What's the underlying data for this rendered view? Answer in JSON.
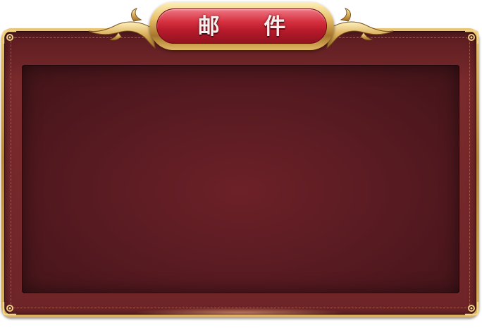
{
  "window": {
    "title": "邮 件"
  },
  "colors": {
    "frame_gold": "#d8b060",
    "panel_red": "#6e2528",
    "content_red": "#5a1b22",
    "title_red": "#d6303f",
    "title_text": "#f3f1ef"
  },
  "icons": {
    "title_ornament": "gold-filigree-wings-icon",
    "corner": "gold-corner-ornament-icon"
  }
}
